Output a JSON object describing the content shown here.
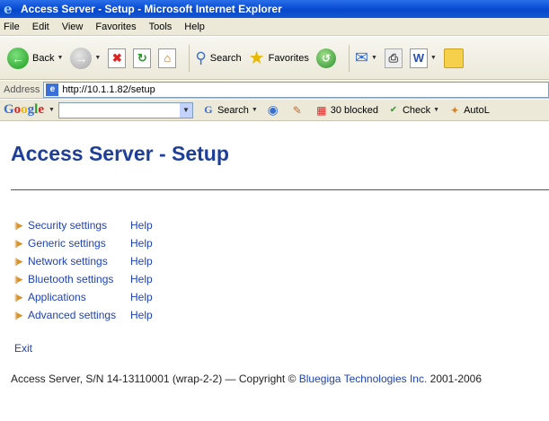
{
  "window": {
    "title": "Access Server - Setup - Microsoft Internet Explorer"
  },
  "menubar": [
    "File",
    "Edit",
    "View",
    "Favorites",
    "Tools",
    "Help"
  ],
  "toolbar": {
    "back_label": "Back",
    "search_label": "Search",
    "favorites_label": "Favorites"
  },
  "address": {
    "label": "Address",
    "url": "http://10.1.1.82/setup"
  },
  "googlebar": {
    "logo": "Google",
    "search_label": "Search",
    "blocked_label": "30 blocked",
    "check_label": "Check",
    "autolink_label": "AutoL"
  },
  "page": {
    "title": "Access Server - Setup",
    "menu": [
      {
        "label": "Security settings",
        "help": "Help"
      },
      {
        "label": "Generic settings",
        "help": "Help"
      },
      {
        "label": "Network settings",
        "help": "Help"
      },
      {
        "label": "Bluetooth settings",
        "help": "Help"
      },
      {
        "label": "Applications",
        "help": "Help"
      },
      {
        "label": "Advanced settings",
        "help": "Help"
      }
    ],
    "exit_label": "Exit",
    "footer": {
      "prefix": "Access Server, S/N 14-13110001 (wrap-2-2) — Copyright © ",
      "company": "Bluegiga Technologies Inc.",
      "suffix": " 2001-2006"
    }
  },
  "colors": {
    "link": "#1f43b0",
    "title": "#1e3f99",
    "titlebar": "#0a4fd6"
  }
}
